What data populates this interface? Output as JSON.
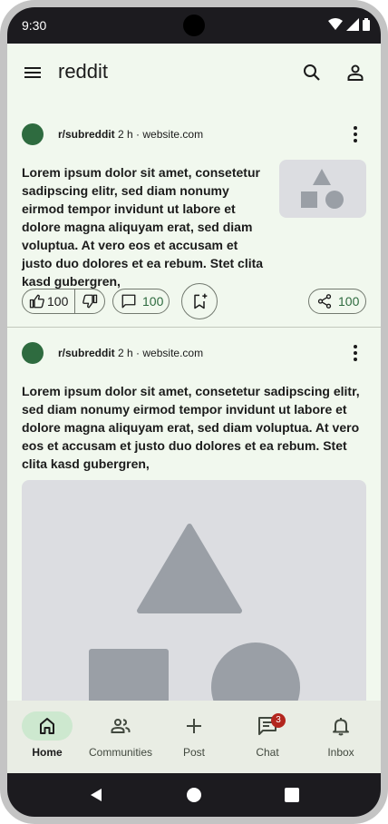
{
  "status_bar": {
    "time": "9:30"
  },
  "app_bar": {
    "title": "reddit",
    "menu_icon": "menu-icon",
    "search_icon": "search-icon",
    "account_icon": "person-icon"
  },
  "posts": [
    {
      "subreddit": "r/subreddit",
      "age": "2 h",
      "separator": "·",
      "source": "website.com",
      "body": "Lorem ipsum dolor sit amet, consetetur sadipscing elitr, sed diam nonumy eirmod tempor invidunt ut labore et dolore magna aliquyam erat, sed diam voluptua. At vero eos et accusam et justo duo dolores et ea rebum. Stet clita kasd gubergren,",
      "upvotes": "100",
      "comments": "100",
      "shares": "100",
      "media": "thumbnail"
    },
    {
      "subreddit": "r/subreddit",
      "age": "2 h",
      "separator": "·",
      "source": "website.com",
      "body": "Lorem ipsum dolor sit amet, consetetur sadipscing elitr, sed diam nonumy eirmod tempor invidunt ut labore et dolore magna aliquyam erat, sed diam voluptua. At vero eos et accusam et justo duo dolores et ea rebum. Stet clita kasd gubergren,",
      "media": "large-image"
    }
  ],
  "bottom_nav": {
    "items": [
      {
        "label": "Home",
        "icon": "home-icon",
        "active": true
      },
      {
        "label": "Communities",
        "icon": "group-icon",
        "active": false
      },
      {
        "label": "Post",
        "icon": "plus-icon",
        "active": false
      },
      {
        "label": "Chat",
        "icon": "chat-icon",
        "active": false,
        "badge": "3"
      },
      {
        "label": "Inbox",
        "icon": "bell-icon",
        "active": false
      }
    ]
  },
  "colors": {
    "background": "#f1f8ee",
    "accent": "#2e6b3f",
    "nav_active": "#cde8cf",
    "badge": "#b3261e",
    "placeholder": "#dcdde1"
  }
}
